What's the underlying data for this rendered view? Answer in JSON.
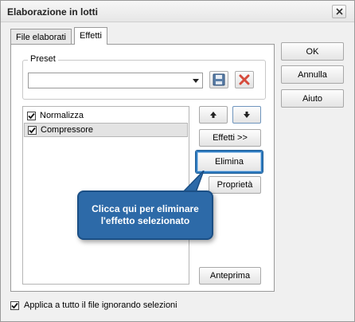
{
  "window": {
    "title": "Elaborazione in lotti"
  },
  "tabs": [
    {
      "label": "File elaborati",
      "active": false
    },
    {
      "label": "Effetti",
      "active": true
    }
  ],
  "preset": {
    "group_label": "Preset",
    "selected_value": "",
    "save_icon": "floppy-disk-icon",
    "delete_icon": "red-x-icon"
  },
  "effects": [
    {
      "label": "Normalizza",
      "checked": true,
      "selected": false
    },
    {
      "label": "Compressore",
      "checked": true,
      "selected": true
    }
  ],
  "side_buttons": {
    "move_up_icon": "arrow-up-icon",
    "move_down_icon": "arrow-down-icon",
    "effects_label": "Effetti >>",
    "delete_label": "Elimina",
    "properties_label": "Proprietà",
    "preview_label": "Anteprima"
  },
  "dialog_buttons": {
    "ok_label": "OK",
    "cancel_label": "Annulla",
    "help_label": "Aiuto"
  },
  "callout": {
    "text": "Clicca qui per eliminare\nl'effetto selezionato"
  },
  "apply_all": {
    "label": "Applica a tutto il file ignorando selezioni",
    "checked": true
  },
  "colors": {
    "callout_bg": "#2d6aa8",
    "highlight_border": "#2f7bbf",
    "delete_icon": "#d64b3c"
  }
}
